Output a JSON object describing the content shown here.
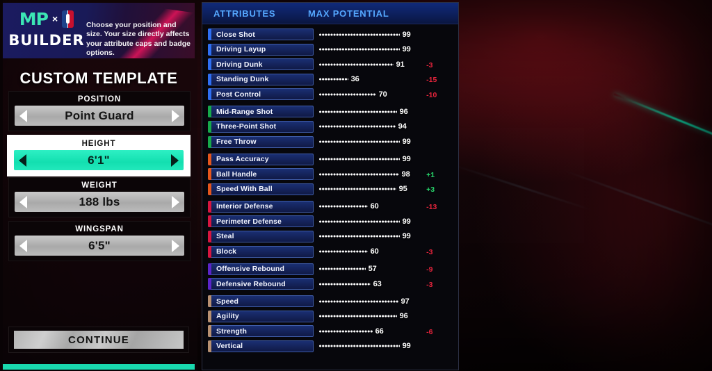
{
  "brand": {
    "mp_text": "MP",
    "x_symbol": "×",
    "nba_logo": "nba-logo-icon",
    "builder_text": "BUILDER",
    "blurb": "Choose your position and size. Your size directly affects your attribute caps and badge options."
  },
  "sidebar": {
    "title": "CUSTOM TEMPLATE",
    "fields": [
      {
        "label": "POSITION",
        "value": "Point Guard",
        "selected": false
      },
      {
        "label": "HEIGHT",
        "value": "6'1\"",
        "selected": true
      },
      {
        "label": "WEIGHT",
        "value": "188 lbs",
        "selected": false
      },
      {
        "label": "WINGSPAN",
        "value": "6'5\"",
        "selected": false
      }
    ],
    "continue_label": "CONTINUE",
    "left_arrow": "left-arrow-icon",
    "right_arrow": "right-arrow-icon"
  },
  "attributes_panel": {
    "header": {
      "attributes": "ATTRIBUTES",
      "max_potential": "MAX POTENTIAL"
    },
    "groups": [
      {
        "name": "finishing",
        "accent": "#2e6ff2",
        "rows": [
          {
            "label": "Close Shot",
            "value": 99,
            "delta": ""
          },
          {
            "label": "Driving Layup",
            "value": 99,
            "delta": ""
          },
          {
            "label": "Driving Dunk",
            "value": 91,
            "delta": "-3"
          },
          {
            "label": "Standing Dunk",
            "value": 36,
            "delta": "-15"
          },
          {
            "label": "Post Control",
            "value": 70,
            "delta": "-10"
          }
        ]
      },
      {
        "name": "shooting",
        "accent": "#16a94a",
        "rows": [
          {
            "label": "Mid-Range Shot",
            "value": 96,
            "delta": ""
          },
          {
            "label": "Three-Point Shot",
            "value": 94,
            "delta": ""
          },
          {
            "label": "Free Throw",
            "value": 99,
            "delta": ""
          }
        ]
      },
      {
        "name": "playmaking",
        "accent": "#e4561c",
        "rows": [
          {
            "label": "Pass Accuracy",
            "value": 99,
            "delta": ""
          },
          {
            "label": "Ball Handle",
            "value": 98,
            "delta": "+1"
          },
          {
            "label": "Speed With Ball",
            "value": 95,
            "delta": "+3"
          }
        ]
      },
      {
        "name": "defense",
        "accent": "#d6153f",
        "rows": [
          {
            "label": "Interior Defense",
            "value": 60,
            "delta": "-13"
          },
          {
            "label": "Perimeter Defense",
            "value": 99,
            "delta": ""
          },
          {
            "label": "Steal",
            "value": 99,
            "delta": ""
          },
          {
            "label": "Block",
            "value": 60,
            "delta": "-3"
          }
        ]
      },
      {
        "name": "rebounding",
        "accent": "#5a24c8",
        "rows": [
          {
            "label": "Offensive Rebound",
            "value": 57,
            "delta": "-9"
          },
          {
            "label": "Defensive Rebound",
            "value": 63,
            "delta": "-3"
          }
        ]
      },
      {
        "name": "physicals",
        "accent": "#b79070",
        "rows": [
          {
            "label": "Speed",
            "value": 97,
            "delta": ""
          },
          {
            "label": "Agility",
            "value": 96,
            "delta": ""
          },
          {
            "label": "Strength",
            "value": 66,
            "delta": "-6"
          },
          {
            "label": "Vertical",
            "value": 99,
            "delta": ""
          }
        ]
      }
    ]
  },
  "theme": {
    "accent_teal": "#19d9ae",
    "header_blue": "#55a8ff",
    "negative": "#e8243c",
    "positive": "#27d46a"
  }
}
